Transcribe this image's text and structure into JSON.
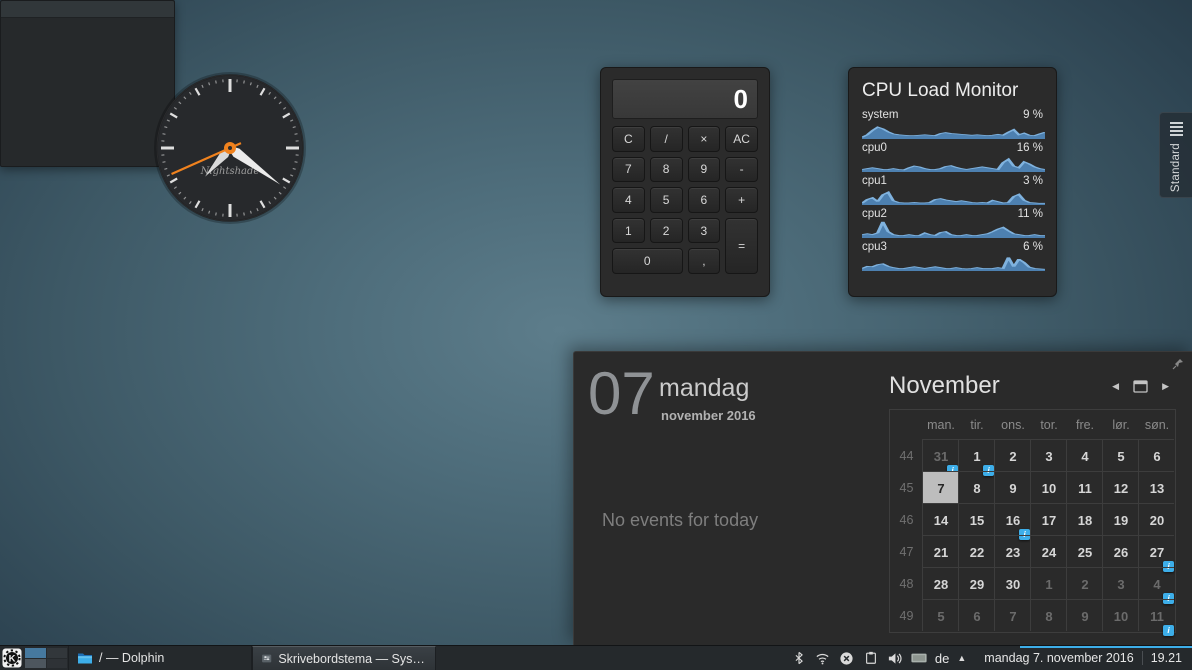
{
  "accent": "#3daee9",
  "clock_widget": {
    "brand": "Nightshade",
    "hands": {
      "hour_deg": 221,
      "minute_deg": 126,
      "second_deg": 246
    }
  },
  "calculator": {
    "display": "0",
    "keys": {
      "c": "C",
      "div": "/",
      "mul": "×",
      "ac": "AC",
      "k7": "7",
      "k8": "8",
      "k9": "9",
      "minus": "-",
      "k4": "4",
      "k5": "5",
      "k6": "6",
      "plus": "+",
      "k1": "1",
      "k2": "2",
      "k3": "3",
      "eq": "=",
      "k0": "0",
      "comma": ","
    }
  },
  "cpu_monitor": {
    "title": "CPU Load Monitor",
    "rows": [
      {
        "label": "system",
        "value": "9 %",
        "points": [
          4,
          10,
          20,
          28,
          24,
          17,
          12,
          10,
          9,
          8,
          8,
          9,
          10,
          9,
          8,
          13,
          15,
          13,
          12,
          11,
          10,
          9,
          10,
          9,
          8,
          9,
          11,
          9,
          16,
          22,
          10,
          14,
          9,
          8,
          12,
          16
        ]
      },
      {
        "label": "cpu0",
        "value": "16 %",
        "points": [
          6,
          8,
          10,
          8,
          6,
          6,
          8,
          6,
          5,
          10,
          14,
          12,
          8,
          6,
          6,
          8,
          13,
          15,
          11,
          8,
          6,
          8,
          10,
          12,
          10,
          8,
          6,
          22,
          30,
          14,
          10,
          24,
          19,
          12,
          8,
          6
        ]
      },
      {
        "label": "cpu1",
        "value": "3 %",
        "points": [
          4,
          13,
          17,
          8,
          24,
          30,
          10,
          6,
          5,
          5,
          6,
          5,
          5,
          6,
          13,
          15,
          12,
          10,
          8,
          10,
          8,
          6,
          5,
          6,
          5,
          11,
          8,
          5,
          6,
          20,
          25,
          11,
          6,
          5,
          4,
          4
        ]
      },
      {
        "label": "cpu2",
        "value": "11 %",
        "points": [
          8,
          10,
          8,
          12,
          38,
          15,
          8,
          6,
          6,
          8,
          6,
          6,
          12,
          8,
          6,
          13,
          15,
          8,
          6,
          6,
          8,
          6,
          6,
          8,
          10,
          15,
          21,
          25,
          17,
          10,
          8,
          6,
          6,
          8,
          6,
          6
        ]
      },
      {
        "label": "cpu3",
        "value": "6 %",
        "points": [
          6,
          11,
          10,
          15,
          17,
          11,
          8,
          6,
          6,
          8,
          10,
          8,
          6,
          8,
          10,
          8,
          6,
          6,
          8,
          6,
          5,
          6,
          8,
          6,
          6,
          6,
          8,
          6,
          32,
          10,
          28,
          20,
          9,
          6,
          5,
          4
        ]
      }
    ]
  },
  "notes_widget": {
    "icons": [
      "format-toolbar-icon",
      "configure-icon"
    ]
  },
  "calendar": {
    "agenda": {
      "day_number": "07",
      "day_name": "mandag",
      "month_year": "november 2016",
      "no_events": "No events for today"
    },
    "month_view": {
      "title": "November",
      "nav": {
        "prev": "◀",
        "next": "▶"
      },
      "badge_glyph": "i",
      "day_headers": [
        "man.",
        "tir.",
        "ons.",
        "tor.",
        "fre.",
        "lør.",
        "søn."
      ],
      "weeks": [
        {
          "num": "44",
          "days": [
            {
              "d": "31",
              "out": true,
              "badge": true
            },
            {
              "d": "1",
              "badge": true
            },
            {
              "d": "2"
            },
            {
              "d": "3"
            },
            {
              "d": "4"
            },
            {
              "d": "5"
            },
            {
              "d": "6"
            }
          ]
        },
        {
          "num": "45",
          "days": [
            {
              "d": "7",
              "selected": true
            },
            {
              "d": "8"
            },
            {
              "d": "9"
            },
            {
              "d": "10"
            },
            {
              "d": "11"
            },
            {
              "d": "12"
            },
            {
              "d": "13"
            }
          ]
        },
        {
          "num": "46",
          "days": [
            {
              "d": "14"
            },
            {
              "d": "15"
            },
            {
              "d": "16",
              "badge": true
            },
            {
              "d": "17"
            },
            {
              "d": "18"
            },
            {
              "d": "19"
            },
            {
              "d": "20"
            }
          ]
        },
        {
          "num": "47",
          "days": [
            {
              "d": "21"
            },
            {
              "d": "22"
            },
            {
              "d": "23"
            },
            {
              "d": "24"
            },
            {
              "d": "25"
            },
            {
              "d": "26"
            },
            {
              "d": "27",
              "badge": true
            }
          ]
        },
        {
          "num": "48",
          "days": [
            {
              "d": "28"
            },
            {
              "d": "29"
            },
            {
              "d": "30"
            },
            {
              "d": "1",
              "out": true
            },
            {
              "d": "2",
              "out": true
            },
            {
              "d": "3",
              "out": true
            },
            {
              "d": "4",
              "out": true,
              "badge": true
            }
          ]
        },
        {
          "num": "49",
          "days": [
            {
              "d": "5",
              "out": true
            },
            {
              "d": "6",
              "out": true
            },
            {
              "d": "7",
              "out": true
            },
            {
              "d": "8",
              "out": true
            },
            {
              "d": "9",
              "out": true
            },
            {
              "d": "10",
              "out": true
            },
            {
              "d": "11",
              "out": true,
              "badge": true
            }
          ]
        }
      ]
    }
  },
  "activity_tab": {
    "label": "Standard"
  },
  "panel": {
    "tasks": [
      {
        "label": "/ — Dolphin"
      },
      {
        "label": "Skrivebordstema  — Systeminnstil..."
      }
    ],
    "tray": {
      "layout_label": "de",
      "expander": "▲"
    },
    "clock": {
      "date": "mandag 7. november 2016",
      "time": "19.21"
    }
  }
}
